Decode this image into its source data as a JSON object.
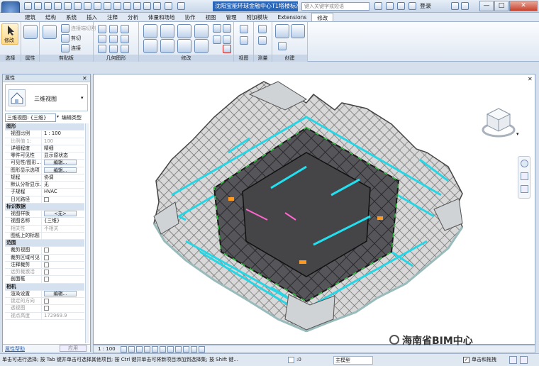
{
  "title": {
    "window_title": "沈阳宝能环球金融中心T1塔楼标准层L2...",
    "search_placeholder": "键入关键字或短语",
    "login": "登录",
    "min": "—",
    "max": "□",
    "close": "✕"
  },
  "menu": [
    "建筑",
    "结构",
    "系统",
    "插入",
    "注释",
    "分析",
    "体量和场地",
    "协作",
    "视图",
    "管理",
    "附加模块",
    "Extensions",
    "修改"
  ],
  "ribbon": {
    "modify_label": "修改",
    "panels": [
      "选择",
      "属性",
      "剪贴板",
      "几何图形",
      "修改",
      "视图",
      "测量",
      "创建"
    ],
    "clipboard": {
      "cut": "剪切",
      "join": "连接",
      "paste_join": "连接端切割"
    }
  },
  "properties": {
    "header": "属性",
    "type_name": "三维视图",
    "view_selector": "三维视图: {三维}",
    "edit_type": "编辑类型",
    "rows": [
      {
        "k": "图形",
        "v": "",
        "grp": true
      },
      {
        "k": "视图比例",
        "v": "1 : 100"
      },
      {
        "k": "比例值 1:",
        "v": "100",
        "dim": true
      },
      {
        "k": "详细程度",
        "v": "精细"
      },
      {
        "k": "零件可见性",
        "v": "显示原状态"
      },
      {
        "k": "可见性/图形...",
        "v": "编辑...",
        "btn": true
      },
      {
        "k": "图形显示选项",
        "v": "编辑...",
        "btn": true
      },
      {
        "k": "规程",
        "v": "协调"
      },
      {
        "k": "默认分析显示...",
        "v": "无"
      },
      {
        "k": "子规程",
        "v": "HVAC"
      },
      {
        "k": "日光路径",
        "v": "",
        "chk": true
      },
      {
        "k": "标识数据",
        "v": "",
        "grp": true
      },
      {
        "k": "视图样板",
        "v": "<无>",
        "btn": true
      },
      {
        "k": "视图名称",
        "v": "{三维}"
      },
      {
        "k": "相关性",
        "v": "不相关",
        "dim": true
      },
      {
        "k": "图纸上的标题",
        "v": ""
      },
      {
        "k": "范围",
        "v": "",
        "grp": true
      },
      {
        "k": "裁剪视图",
        "v": "",
        "chk": true
      },
      {
        "k": "裁剪区域可见",
        "v": "",
        "chk": true
      },
      {
        "k": "注释裁剪",
        "v": "",
        "chk": true
      },
      {
        "k": "远剪裁激活",
        "v": "",
        "chk": true,
        "dim": true
      },
      {
        "k": "剖面框",
        "v": "",
        "chk": true
      },
      {
        "k": "相机",
        "v": "",
        "grp": true
      },
      {
        "k": "渲染设置",
        "v": "编辑...",
        "btn": true
      },
      {
        "k": "锁定的方向",
        "v": "",
        "chk": true,
        "dim": true
      },
      {
        "k": "透视图",
        "v": "",
        "chk": true,
        "dim": true
      },
      {
        "k": "视点高度",
        "v": "172969.9",
        "dim": true
      }
    ],
    "help": "属性帮助",
    "apply": "应用"
  },
  "viewport": {
    "close": "✕"
  },
  "view_control": {
    "scale": "1 : 100"
  },
  "status": {
    "text": "单击可进行选择; 按 Tab 键并单击可选择其他项目; 按 Ctrl 键并单击可将新项目添加到选择集; 按 Shift 键...",
    "zero": ":0",
    "workset": "主模型",
    "filter": "单击和拖拽"
  },
  "watermark": "海南省BIM中心"
}
